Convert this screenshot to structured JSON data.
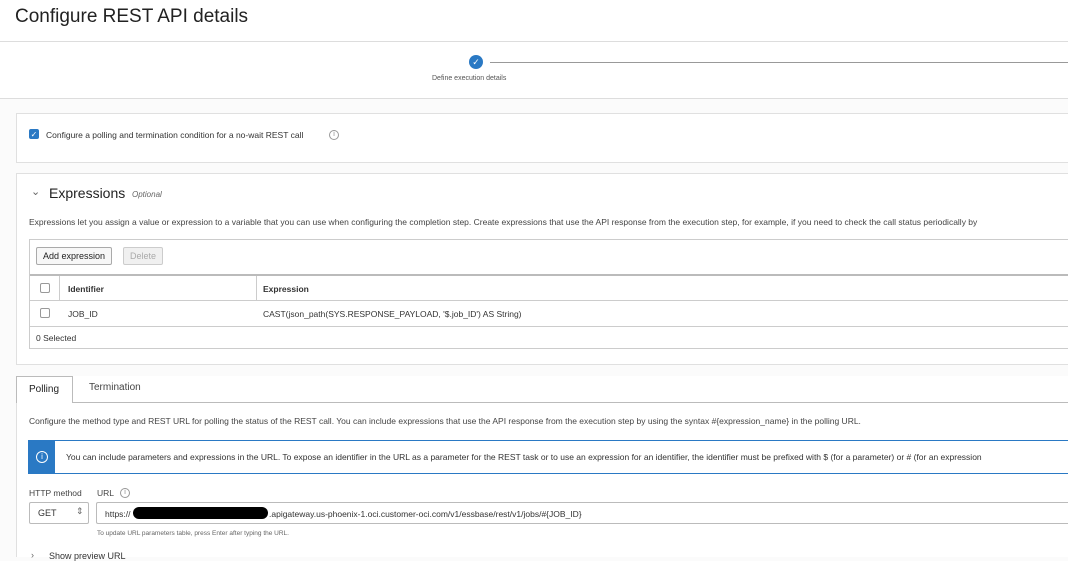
{
  "header": {
    "title": "Configure REST API details"
  },
  "stepper": {
    "steps": [
      {
        "label": "Define execution details",
        "status": "complete"
      }
    ]
  },
  "polling_option": {
    "label": "Configure a polling and termination condition for a no-wait REST call",
    "checked": true
  },
  "expressions": {
    "title": "Expressions",
    "optional": "Optional",
    "description": "Expressions let you assign a value or expression to a variable that you can use when configuring the completion step. Create expressions that use the API response from the execution step, for example, if you need to check the call status periodically by",
    "add_button": "Add expression",
    "delete_button": "Delete",
    "columns": [
      "Identifier",
      "Expression"
    ],
    "rows": [
      {
        "identifier": "JOB_ID",
        "expression": "CAST(json_path(SYS.RESPONSE_PAYLOAD, '$.job_ID') AS String)"
      }
    ],
    "selected_count": "0 Selected"
  },
  "tabs": [
    {
      "label": "Polling",
      "active": true
    },
    {
      "label": "Termination",
      "active": false
    }
  ],
  "polling": {
    "description": "Configure the method type and REST URL for polling the status of the REST call. You can include expressions that use the API response from the execution step by using the syntax #{expression_name} in the polling URL.",
    "info_banner": "You can include parameters and expressions in the URL. To expose an identifier in the URL as a parameter for the REST task or to use an expression for an identifier, the identifier must be prefixed with $ (for a parameter) or # (for an expression",
    "method_label": "HTTP method",
    "method_value": "GET",
    "url_label": "URL",
    "url_prefix": "https://",
    "url_suffix": ".apigateway.us-phoenix-1.oci.customer-oci.com/v1/essbase/rest/v1/jobs/#{JOB_ID}",
    "url_hint": "To update URL parameters table, press Enter after typing the URL.",
    "preview_link": "Show preview URL"
  },
  "colors": {
    "accent": "#2a79c4"
  }
}
